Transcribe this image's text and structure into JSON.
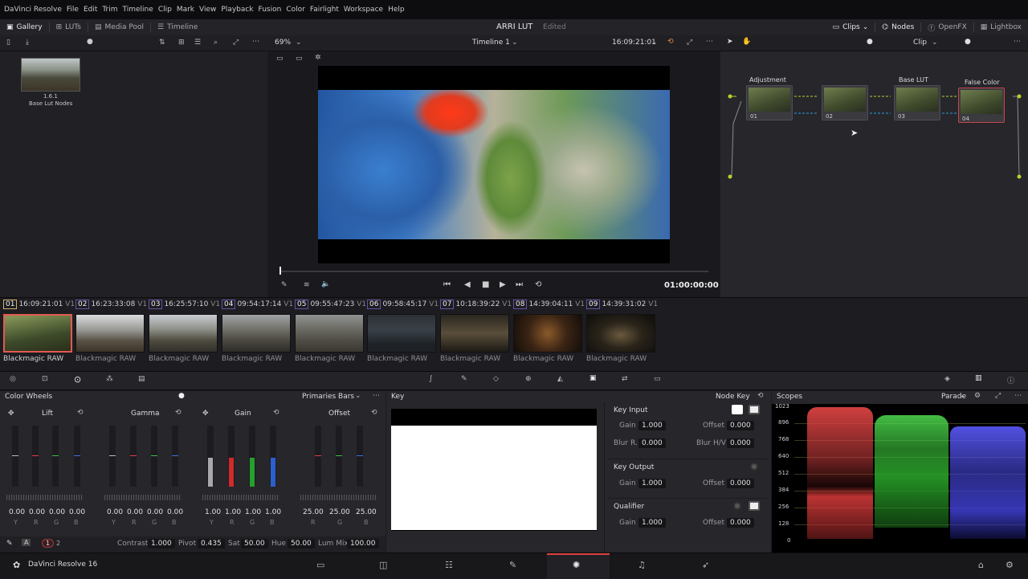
{
  "menu": [
    "DaVinci Resolve",
    "File",
    "Edit",
    "Trim",
    "Timeline",
    "Clip",
    "Mark",
    "View",
    "Playback",
    "Fusion",
    "Color",
    "Fairlight",
    "Workspace",
    "Help"
  ],
  "tabs_left": [
    {
      "label": "Gallery",
      "icon": "gallery-icon"
    },
    {
      "label": "LUTs",
      "icon": "luts-icon"
    },
    {
      "label": "Media Pool",
      "icon": "media-pool-icon"
    },
    {
      "label": "Timeline",
      "icon": "timeline-icon"
    }
  ],
  "project": {
    "title": "ARRI LUT",
    "status": "Edited"
  },
  "tabs_right": [
    {
      "label": "Clips",
      "icon": "clips-icon"
    },
    {
      "label": "Nodes",
      "icon": "nodes-icon"
    },
    {
      "label": "OpenFX",
      "icon": "fx-icon"
    },
    {
      "label": "Lightbox",
      "icon": "lightbox-icon"
    }
  ],
  "viewer": {
    "zoom": "69%",
    "timeline_name": "Timeline 1",
    "timecode": "16:09:21:01",
    "playhead_tc": "01:00:00:00"
  },
  "node_panel": {
    "mode": "Clip"
  },
  "gallery": {
    "still_version": "1.6.1",
    "still_name": "Base Lut Nodes"
  },
  "nodes": [
    {
      "title": "Adjustment",
      "label": "01"
    },
    {
      "title": "",
      "label": "02"
    },
    {
      "title": "Base LUT",
      "label": "03"
    },
    {
      "title": "False Color",
      "label": "04"
    }
  ],
  "clips": [
    {
      "num": "01",
      "tc": "16:09:21:01",
      "track": "V1",
      "codec": "Blackmagic RAW"
    },
    {
      "num": "02",
      "tc": "16:23:33:08",
      "track": "V1",
      "codec": "Blackmagic RAW"
    },
    {
      "num": "03",
      "tc": "16:25:57:10",
      "track": "V1",
      "codec": "Blackmagic RAW"
    },
    {
      "num": "04",
      "tc": "09:54:17:14",
      "track": "V1",
      "codec": "Blackmagic RAW"
    },
    {
      "num": "05",
      "tc": "09:55:47:23",
      "track": "V1",
      "codec": "Blackmagic RAW"
    },
    {
      "num": "06",
      "tc": "09:58:45:17",
      "track": "V1",
      "codec": "Blackmagic RAW"
    },
    {
      "num": "07",
      "tc": "10:18:39:22",
      "track": "V1",
      "codec": "Blackmagic RAW"
    },
    {
      "num": "08",
      "tc": "14:39:04:11",
      "track": "V1",
      "codec": "Blackmagic RAW"
    },
    {
      "num": "09",
      "tc": "14:39:31:02",
      "track": "V1",
      "codec": "Blackmagic RAW"
    }
  ],
  "wheels": {
    "title": "Color Wheels",
    "mode": "Primaries Bars",
    "groups": [
      {
        "name": "Lift",
        "values": [
          "0.00",
          "0.00",
          "0.00",
          "0.00"
        ],
        "channels": [
          "Y",
          "R",
          "G",
          "B"
        ]
      },
      {
        "name": "Gamma",
        "values": [
          "0.00",
          "0.00",
          "0.00",
          "0.00"
        ],
        "channels": [
          "Y",
          "R",
          "G",
          "B"
        ]
      },
      {
        "name": "Gain",
        "values": [
          "1.00",
          "1.00",
          "1.00",
          "1.00"
        ],
        "channels": [
          "Y",
          "R",
          "G",
          "B"
        ]
      },
      {
        "name": "Offset",
        "values": [
          "25.00",
          "25.00",
          "25.00"
        ],
        "channels": [
          "R",
          "G",
          "B"
        ]
      }
    ],
    "footer": {
      "page1": "1",
      "page2": "2",
      "contrast_label": "Contrast",
      "contrast": "1.000",
      "pivot_label": "Pivot",
      "pivot": "0.435",
      "sat_label": "Sat",
      "sat": "50.00",
      "hue_label": "Hue",
      "hue": "50.00",
      "lummix_label": "Lum Mix",
      "lummix": "100.00"
    }
  },
  "key": {
    "title": "Key",
    "node_key": "Node Key",
    "key_input": {
      "title": "Key Input",
      "gain_label": "Gain",
      "gain": "1.000",
      "offset_label": "Offset",
      "offset": "0.000",
      "blur_r_label": "Blur R.",
      "blur_r": "0.000",
      "blur_hv_label": "Blur H/V",
      "blur_hv": "0.000"
    },
    "key_output": {
      "title": "Key Output",
      "gain_label": "Gain",
      "gain": "1.000",
      "offset_label": "Offset",
      "offset": "0.000"
    },
    "qualifier": {
      "title": "Qualifier",
      "gain_label": "Gain",
      "gain": "1.000",
      "offset_label": "Offset",
      "offset": "0.000"
    }
  },
  "scopes": {
    "title": "Scopes",
    "mode": "Parade",
    "scale": [
      "1023",
      "896",
      "768",
      "640",
      "512",
      "384",
      "256",
      "128",
      "0"
    ]
  },
  "app": {
    "name": "DaVinci Resolve 16"
  },
  "colors": {
    "accent_red": "#e0413c",
    "node_selected": "#c9434c",
    "clip_selected": "#e25a4f",
    "link_green": "#b6d12a",
    "link_blue": "#2aa0e0"
  }
}
